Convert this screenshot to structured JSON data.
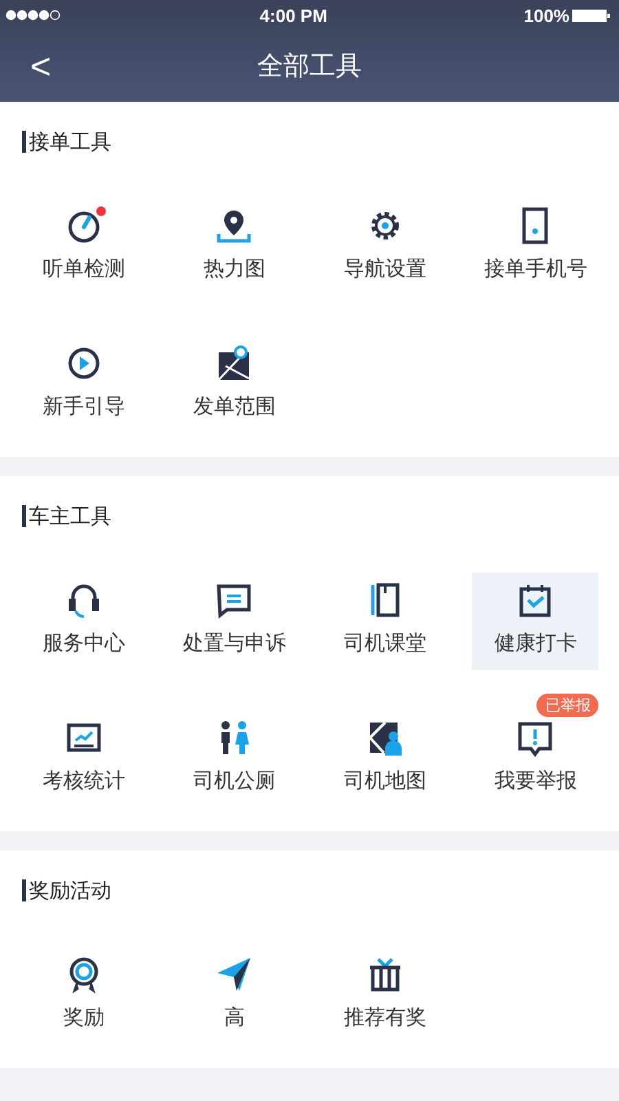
{
  "status_bar": {
    "time": "4:00 PM",
    "battery": "100%"
  },
  "nav": {
    "back": "<",
    "title": "全部工具"
  },
  "sections": [
    {
      "title": "接单工具",
      "items": [
        {
          "label": "听单检测",
          "dot": true,
          "highlighted": false
        },
        {
          "label": "热力图",
          "dot": false,
          "highlighted": false
        },
        {
          "label": "导航设置",
          "dot": false,
          "highlighted": false
        },
        {
          "label": "接单手机号",
          "dot": false,
          "highlighted": false
        },
        {
          "label": "新手引导",
          "dot": false,
          "highlighted": false
        },
        {
          "label": "发单范围",
          "dot": false,
          "highlighted": false
        }
      ]
    },
    {
      "title": "车主工具",
      "items": [
        {
          "label": "服务中心",
          "dot": false,
          "highlighted": false
        },
        {
          "label": "处置与申诉",
          "dot": false,
          "highlighted": false
        },
        {
          "label": "司机课堂",
          "dot": false,
          "highlighted": false
        },
        {
          "label": "健康打卡",
          "dot": false,
          "highlighted": true
        },
        {
          "label": "考核统计",
          "dot": false,
          "highlighted": false
        },
        {
          "label": "司机公厕",
          "dot": false,
          "highlighted": false
        },
        {
          "label": "司机地图",
          "dot": false,
          "highlighted": false
        },
        {
          "label": "我要举报",
          "dot": false,
          "highlighted": false,
          "badge": "已举报"
        }
      ]
    },
    {
      "title": "奖励活动",
      "items": [
        {
          "label": "奖励",
          "dot": false,
          "highlighted": false
        },
        {
          "label": "高",
          "dot": false,
          "highlighted": false
        },
        {
          "label": "推荐有奖",
          "dot": false,
          "highlighted": false
        }
      ]
    }
  ]
}
